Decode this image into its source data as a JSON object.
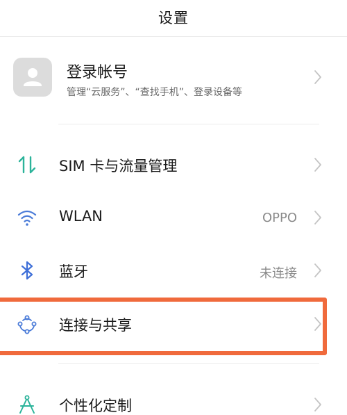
{
  "header": {
    "title": "设置"
  },
  "account": {
    "name": "登录帐号",
    "subtitle": "管理“云服务”、“查找手机”、登录设备等",
    "avatar_icon": "person-icon"
  },
  "settings": [
    {
      "id": "sim",
      "label": "SIM 卡与流量管理",
      "value": "",
      "icon": "sim-data-icon",
      "icon_color": "#2bb39a"
    },
    {
      "id": "wlan",
      "label": "WLAN",
      "value": "OPPO",
      "icon": "wifi-icon",
      "icon_color": "#4a7bd8"
    },
    {
      "id": "bluetooth",
      "label": "蓝牙",
      "value": "未连接",
      "icon": "bluetooth-icon",
      "icon_color": "#3e6fd8"
    },
    {
      "id": "connection",
      "label": "连接与共享",
      "value": "",
      "icon": "connection-share-icon",
      "icon_color": "#4a7bd8"
    },
    {
      "id": "personalize",
      "label": "个性化定制",
      "value": "",
      "icon": "personalize-icon",
      "icon_color": "#2bb39a"
    }
  ],
  "colors": {
    "highlight": "#f06a3c",
    "chevron": "#c4c4c4",
    "divider": "#ececec"
  }
}
